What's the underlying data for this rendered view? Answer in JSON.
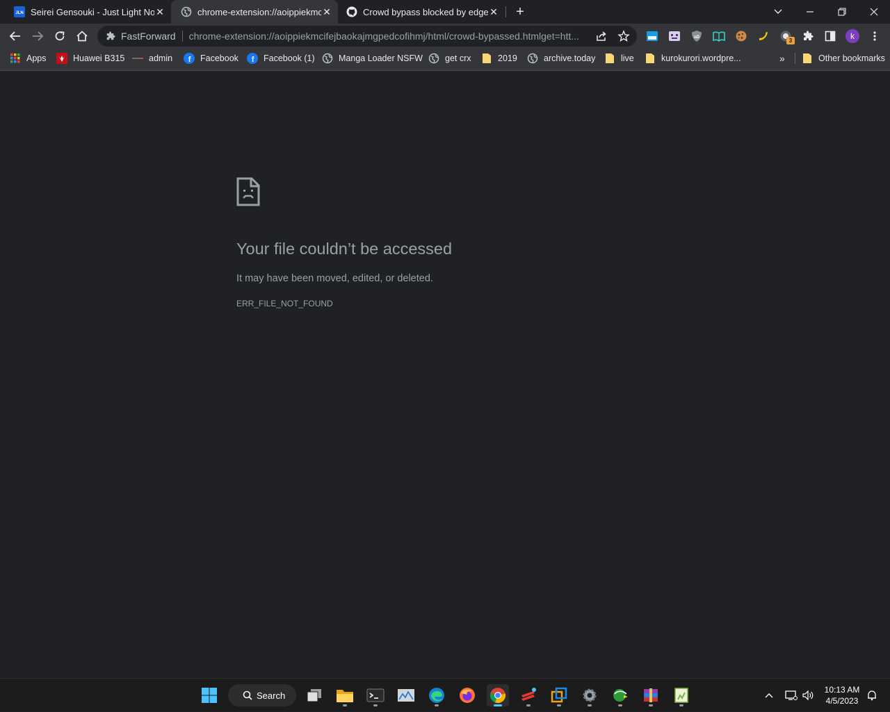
{
  "tabs": [
    {
      "title": "Seirei Gensouki - Just Light Nove",
      "icon": "jln-logo-icon",
      "active": false
    },
    {
      "title": "chrome-extension://aoippiekmcif",
      "icon": "globe-icon",
      "active": true
    },
    {
      "title": "Crowd bypass blocked by edge ·",
      "icon": "github-icon",
      "active": false
    }
  ],
  "omnibox": {
    "chip_label": "FastForward",
    "url": "chrome-extension://aoippiekmcifejbaokajmgpedcofihmj/html/crowd-bypassed.htmlget=htt..."
  },
  "profile": {
    "initial": "k",
    "color": "#7b3fbf"
  },
  "extensions": {
    "badge_count": "3"
  },
  "bookmarks": [
    {
      "label": "Apps",
      "icon": "apps-grid-icon"
    },
    {
      "label": "Huawei B315",
      "icon": "huawei-icon"
    },
    {
      "label": "admin",
      "icon": "admin-icon"
    },
    {
      "label": "Facebook",
      "icon": "facebook-icon"
    },
    {
      "label": "Facebook (1)",
      "icon": "facebook-icon"
    },
    {
      "label": "Manga Loader NSFW",
      "icon": "globe-icon"
    },
    {
      "label": "get crx",
      "icon": "globe-icon"
    },
    {
      "label": "2019",
      "icon": "folder-icon"
    },
    {
      "label": "archive.today",
      "icon": "globe-icon"
    },
    {
      "label": "live",
      "icon": "folder-icon"
    },
    {
      "label": "kurokurori.wordpre...",
      "icon": "folder-icon"
    }
  ],
  "bookmarks_overflow": "»",
  "other_bookmarks": "Other bookmarks",
  "error": {
    "title": "Your file couldn’t be accessed",
    "message": "It may have been moved, edited, or deleted.",
    "code": "ERR_FILE_NOT_FOUND"
  },
  "taskbar": {
    "search_label": "Search",
    "time": "10:13 AM",
    "date": "4/5/2023"
  },
  "colors": {
    "page_bg": "#202124",
    "toolbar_bg": "#35363a",
    "taskbar_bg": "#1c1c1c",
    "accent": "#4cc2ff"
  }
}
